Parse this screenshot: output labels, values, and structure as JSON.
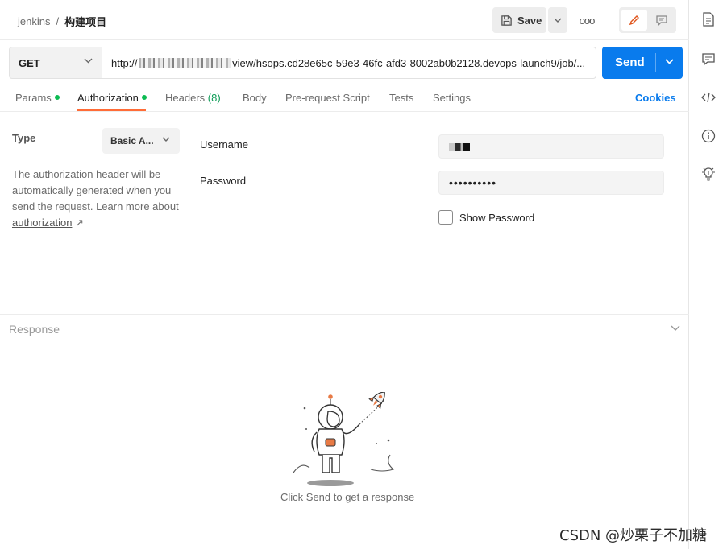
{
  "header": {
    "breadcrumb_parent": "jenkins",
    "breadcrumb_separator": "/",
    "breadcrumb_current": "构建项目",
    "save_label": "Save",
    "more_label": "ooo"
  },
  "request": {
    "method": "GET",
    "url_prefix": "http://",
    "url_rest": "view/hsops.cd28e65c-59e3-46fc-afd3-8002ab0b2128.devops-launch9/job/...",
    "send_label": "Send"
  },
  "tabs": [
    {
      "label": "Params",
      "dot": true
    },
    {
      "label": "Authorization",
      "dot": true
    },
    {
      "label": "Headers",
      "count": "(8)"
    },
    {
      "label": "Body"
    },
    {
      "label": "Pre-request Script"
    },
    {
      "label": "Tests"
    },
    {
      "label": "Settings"
    }
  ],
  "cookies_label": "Cookies",
  "auth": {
    "type_label": "Type",
    "type_value": "Basic A...",
    "help_text": "The authorization header will be automatically generated when you send the request. Learn more about",
    "help_link": "authorization",
    "help_link_arrow": "↗",
    "username_label": "Username",
    "password_label": "Password",
    "password_value": "••••••••••",
    "show_password_label": "Show Password",
    "show_password_checked": false
  },
  "response": {
    "title": "Response",
    "hint": "Click Send to get a response"
  },
  "watermark": "CSDN @炒栗子不加糖",
  "colors": {
    "accent": "#097bed",
    "active_tab_underline": "#ff6c37",
    "status_dot": "#0cbb52"
  },
  "right_sidebar_icons": [
    "document-icon",
    "comment-icon",
    "code-icon",
    "info-icon",
    "lightbulb-icon"
  ]
}
